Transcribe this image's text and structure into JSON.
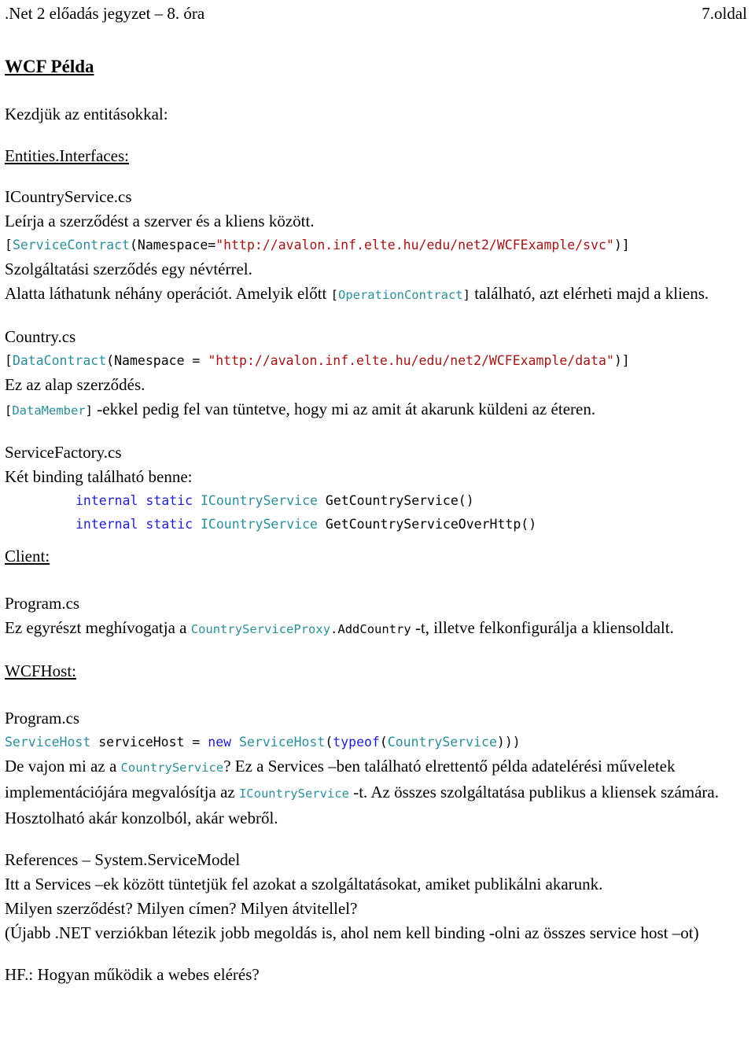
{
  "header": {
    "left": ".Net 2 előadás jegyzet – 8. óra",
    "right": "7.oldal"
  },
  "title": "WCF Példa",
  "colors": {
    "type": "#2b8f99",
    "keyword": "#2222cc",
    "string": "#a31515",
    "text": "#000000",
    "background": "#ffffff"
  },
  "intro": {
    "line": "Kezdjük az entitásokkal:"
  },
  "sections": {
    "entities_interfaces": {
      "heading": "Entities.Interfaces:",
      "file1": "ICountryService.cs",
      "desc1": "Leírja a szerződést a szerver és a kliens között.",
      "code1": {
        "bracket_open": "[",
        "type": "ServiceContract",
        "paren_open": "(",
        "attr": "Namespace=",
        "string": "\"http://avalon.inf.elte.hu/edu/net2/WCFExample/svc\"",
        "tail": ")]"
      },
      "desc2": "Szolgáltatási szerződés egy névtérrel.",
      "desc3_a": "Alatta láthatunk néhány operációt. Amelyik előtt ",
      "desc3_code_open": "[",
      "desc3_code": "OperationContract",
      "desc3_code_close": "]",
      "desc3_b": " található, azt elérheti majd a kliens.",
      "file2": "Country.cs",
      "code2": {
        "bracket_open": "[",
        "type": "DataContract",
        "paren_open": "(",
        "attr": "Namespace = ",
        "string": "\"http://avalon.inf.elte.hu/edu/net2/WCFExample/data\"",
        "tail": ")]"
      },
      "desc4": "Ez az alap szerződés.",
      "desc5_code_open": "[",
      "desc5_code": "DataMember",
      "desc5_code_close": "]",
      "desc5_text": " -ekkel pedig fel van tüntetve, hogy mi az amit át akarunk küldeni az éteren.",
      "file3": "ServiceFactory.cs",
      "desc6": "Két binding található benne:",
      "code3": {
        "kw1": "internal",
        "kw2": "static",
        "type": "ICountryService",
        "method": "GetCountryService()"
      },
      "code4": {
        "kw1": "internal",
        "kw2": "static",
        "type": "ICountryService",
        "method": "GetCountryServiceOverHttp()"
      }
    },
    "client": {
      "heading": "Client:",
      "file1": "Program.cs",
      "desc1_a": "Ez egyrészt meghívogatja a ",
      "desc1_code1": "CountryServiceProxy",
      "desc1_code2": ".AddCountry",
      "desc1_b": " -t, illetve felkonfigurálja a kliensoldalt."
    },
    "wcfhost": {
      "heading": "WCFHost:",
      "file1": "Program.cs",
      "code1": {
        "type1": "ServiceHost",
        "var": " serviceHost = ",
        "kw_new": "new",
        "type2": "ServiceHost",
        "paren1": "(",
        "kw_typeof": "typeof",
        "paren2": "(",
        "type3": "CountryService",
        "tail": ")))"
      },
      "desc1_a": "De vajon mi az a ",
      "desc1_code1": "CountryService",
      "desc1_b": "? Ez a Services –ben található elrettentő példa adatelérési műveletek implementációjára megvalósítja az ",
      "desc1_code2": "ICountryService",
      "desc1_c": " -t. Az összes szolgáltatása publikus a kliensek számára. Hosztolható akár konzolból, akár webről."
    },
    "references": {
      "line1": "References – System.ServiceModel",
      "line2": "Itt a Services –ek között tüntetjük fel azokat a szolgáltatásokat, amiket publikálni akarunk.",
      "line3": "Milyen szerződést? Milyen címen? Milyen átvitellel?",
      "line4": "(Újabb .NET verziókban létezik jobb megoldás is, ahol nem kell binding -olni az összes service host –ot)"
    },
    "homework": {
      "line": "HF.: Hogyan működik a webes elérés?"
    }
  }
}
